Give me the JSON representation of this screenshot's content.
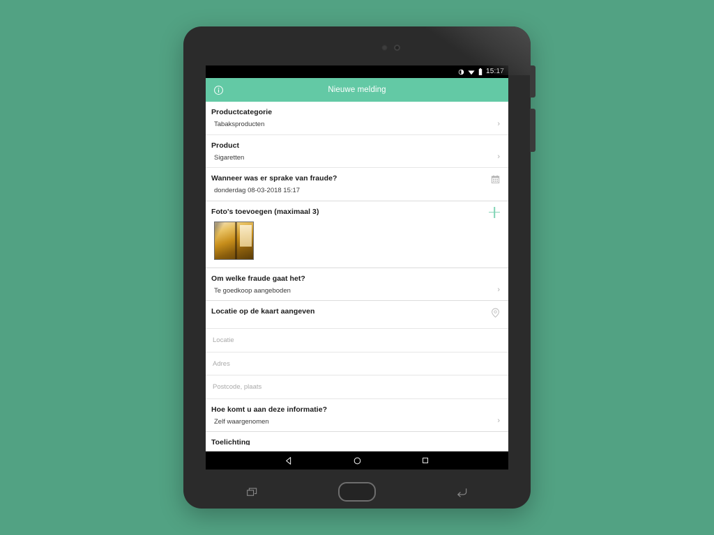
{
  "device": {
    "name": "android-tablet",
    "hardware_keys": [
      {
        "name": "recents-hw-key",
        "icon": "recents-icon"
      },
      {
        "name": "home-hw-key",
        "icon": "home-pill-icon"
      },
      {
        "name": "back-hw-key",
        "icon": "back-arrow-icon"
      }
    ]
  },
  "colors": {
    "wallpaper": "#52a283",
    "app_bar": "#63c9a5",
    "accent": "#7fd3b4",
    "screen_background": "#ffffff",
    "text_primary": "#1b1b1b",
    "text_secondary": "#3a3a3a",
    "placeholder": "#a9a9a9",
    "divider": "#e6e6e6",
    "system_bar": "#000000"
  },
  "status_bar": {
    "clock": "15:17",
    "icons": [
      "screen-rotation-icon",
      "wifi-icon",
      "battery-icon"
    ]
  },
  "app_bar": {
    "title": "Nieuwe melding",
    "info_icon": "info-circle-icon"
  },
  "form": {
    "rows": [
      {
        "key": "productcategorie",
        "label": "Productcategorie",
        "value": "Tabaksproducten",
        "trailing": "chevron-right-icon"
      },
      {
        "key": "product",
        "label": "Product",
        "value": "Sigaretten",
        "trailing": "chevron-right-icon"
      },
      {
        "key": "datum-fraude",
        "label": "Wanneer was er sprake van fraude?",
        "value": "donderdag 08-03-2018 15:17",
        "trailing": "calendar-icon"
      },
      {
        "key": "fotos",
        "label": "Foto's toevoegen (maximaal 3)",
        "trailing": "plus-icon",
        "thumbnails": 1
      },
      {
        "key": "soort-fraude",
        "label": "Om welke fraude gaat het?",
        "value": "Te goedkoop aangeboden",
        "trailing": "chevron-right-icon"
      },
      {
        "key": "locatie-kaart",
        "label": "Locatie op de kaart aangeven",
        "trailing": "map-pin-icon"
      }
    ],
    "inputs": [
      {
        "key": "locatie",
        "placeholder": "Locatie",
        "value": ""
      },
      {
        "key": "adres",
        "placeholder": "Adres",
        "value": ""
      },
      {
        "key": "postcode-plaats",
        "placeholder": "Postcode, plaats",
        "value": ""
      }
    ],
    "rows_after_inputs": [
      {
        "key": "herkomst-informatie",
        "label": "Hoe komt u aan deze informatie?",
        "value": "Zelf waargenomen",
        "trailing": "chevron-right-icon"
      }
    ],
    "clipped_row": {
      "key": "toelichting",
      "label": "Toelichting"
    }
  },
  "nav_bar": {
    "keys": [
      {
        "name": "nav-back",
        "icon": "back-triangle-icon"
      },
      {
        "name": "nav-home",
        "icon": "home-circle-icon"
      },
      {
        "name": "nav-recents",
        "icon": "recents-square-icon"
      }
    ]
  }
}
